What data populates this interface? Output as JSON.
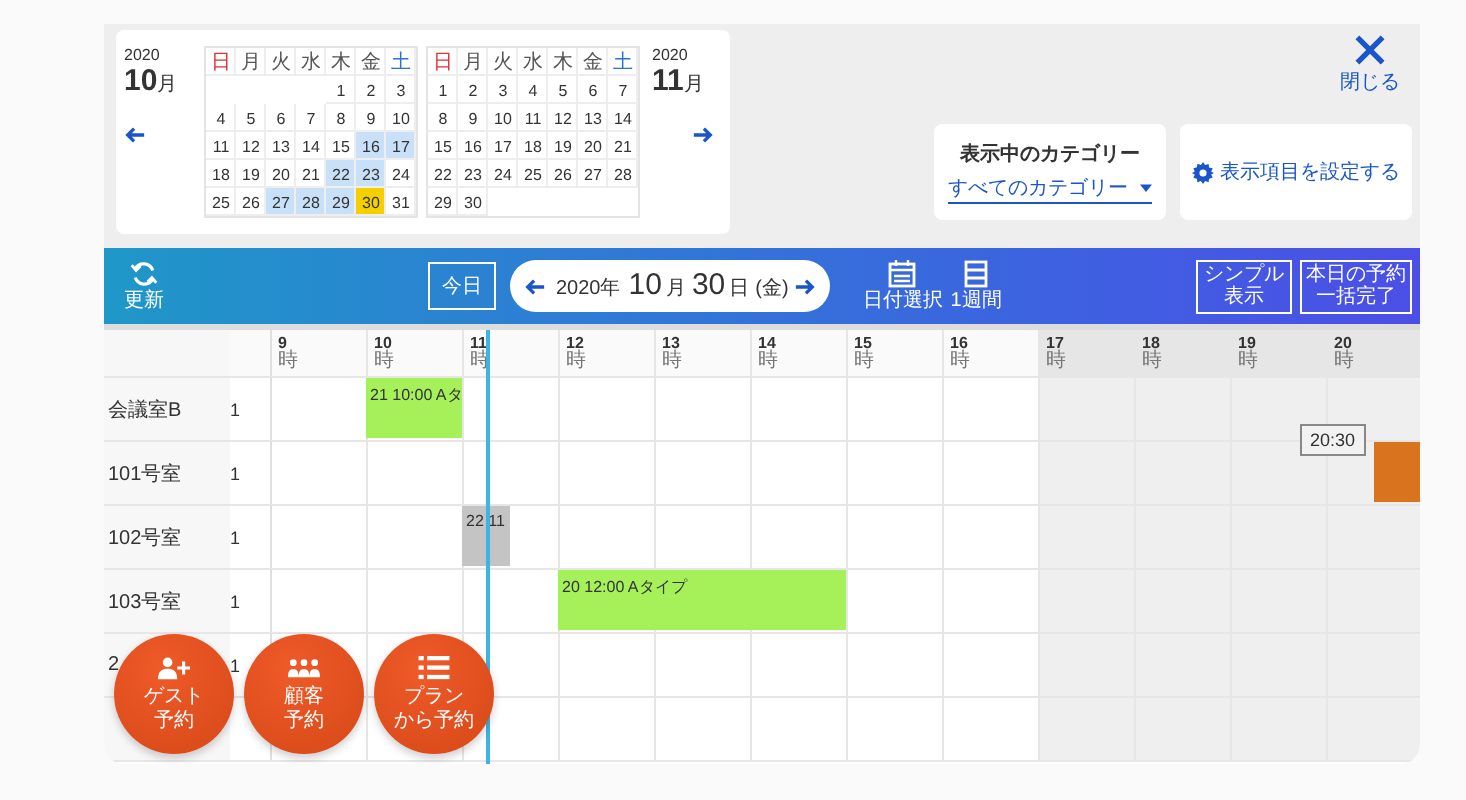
{
  "calendar": {
    "months": [
      {
        "year": "2020",
        "month": "10",
        "unit": "月",
        "weekdays": [
          {
            "label": "日",
            "kind": "sun"
          },
          {
            "label": "月",
            "kind": "day"
          },
          {
            "label": "火",
            "kind": "day"
          },
          {
            "label": "水",
            "kind": "day"
          },
          {
            "label": "木",
            "kind": "day"
          },
          {
            "label": "金",
            "kind": "day"
          },
          {
            "label": "土",
            "kind": "sat"
          }
        ],
        "weeks": [
          {
            "days": [
              {
                "day": "1",
                "selected": false,
                "today": false
              },
              {
                "day": "2",
                "selected": false,
                "today": false
              },
              {
                "day": "3",
                "selected": false,
                "today": false
              }
            ]
          },
          {
            "days": [
              {
                "day": "4",
                "selected": false,
                "today": false
              },
              {
                "day": "5",
                "selected": false,
                "today": false
              },
              {
                "day": "6",
                "selected": false,
                "today": false
              },
              {
                "day": "7",
                "selected": false,
                "today": false
              },
              {
                "day": "8",
                "selected": false,
                "today": false
              },
              {
                "day": "9",
                "selected": false,
                "today": false
              },
              {
                "day": "10",
                "selected": false,
                "today": false
              }
            ]
          },
          {
            "days": [
              {
                "day": "11",
                "selected": false,
                "today": false
              },
              {
                "day": "12",
                "selected": false,
                "today": false
              },
              {
                "day": "13",
                "selected": false,
                "today": false
              },
              {
                "day": "14",
                "selected": false,
                "today": false
              },
              {
                "day": "15",
                "selected": false,
                "today": false
              },
              {
                "day": "16",
                "selected": true,
                "today": false
              },
              {
                "day": "17",
                "selected": true,
                "today": false
              }
            ]
          },
          {
            "days": [
              {
                "day": "18",
                "selected": false,
                "today": false
              },
              {
                "day": "19",
                "selected": false,
                "today": false
              },
              {
                "day": "20",
                "selected": false,
                "today": false
              },
              {
                "day": "21",
                "selected": false,
                "today": false
              },
              {
                "day": "22",
                "selected": true,
                "today": false
              },
              {
                "day": "23",
                "selected": true,
                "today": false
              },
              {
                "day": "24",
                "selected": false,
                "today": false
              }
            ]
          },
          {
            "days": [
              {
                "day": "25",
                "selected": false,
                "today": false
              },
              {
                "day": "26",
                "selected": false,
                "today": false
              },
              {
                "day": "27",
                "selected": true,
                "today": false
              },
              {
                "day": "28",
                "selected": true,
                "today": false
              },
              {
                "day": "29",
                "selected": true,
                "today": false
              },
              {
                "day": "30",
                "selected": false,
                "today": true
              },
              {
                "day": "31",
                "selected": false,
                "today": false
              }
            ]
          }
        ]
      },
      {
        "year": "2020",
        "month": "11",
        "unit": "月",
        "weekdays": [
          {
            "label": "日",
            "kind": "sun"
          },
          {
            "label": "月",
            "kind": "day"
          },
          {
            "label": "火",
            "kind": "day"
          },
          {
            "label": "水",
            "kind": "day"
          },
          {
            "label": "木",
            "kind": "day"
          },
          {
            "label": "金",
            "kind": "day"
          },
          {
            "label": "土",
            "kind": "sat"
          }
        ],
        "weeks": [
          {
            "days": [
              {
                "day": "1",
                "selected": false,
                "today": false
              },
              {
                "day": "2",
                "selected": false,
                "today": false
              },
              {
                "day": "3",
                "selected": false,
                "today": false
              },
              {
                "day": "4",
                "selected": false,
                "today": false
              },
              {
                "day": "5",
                "selected": false,
                "today": false
              },
              {
                "day": "6",
                "selected": false,
                "today": false
              },
              {
                "day": "7",
                "selected": false,
                "today": false
              }
            ]
          },
          {
            "days": [
              {
                "day": "8",
                "selected": false,
                "today": false
              },
              {
                "day": "9",
                "selected": false,
                "today": false
              },
              {
                "day": "10",
                "selected": false,
                "today": false
              },
              {
                "day": "11",
                "selected": false,
                "today": false
              },
              {
                "day": "12",
                "selected": false,
                "today": false
              },
              {
                "day": "13",
                "selected": false,
                "today": false
              },
              {
                "day": "14",
                "selected": false,
                "today": false
              }
            ]
          },
          {
            "days": [
              {
                "day": "15",
                "selected": false,
                "today": false
              },
              {
                "day": "16",
                "selected": false,
                "today": false
              },
              {
                "day": "17",
                "selected": false,
                "today": false
              },
              {
                "day": "18",
                "selected": false,
                "today": false
              },
              {
                "day": "19",
                "selected": false,
                "today": false
              },
              {
                "day": "20",
                "selected": false,
                "today": false
              },
              {
                "day": "21",
                "selected": false,
                "today": false
              }
            ]
          },
          {
            "days": [
              {
                "day": "22",
                "selected": false,
                "today": false
              },
              {
                "day": "23",
                "selected": false,
                "today": false
              },
              {
                "day": "24",
                "selected": false,
                "today": false
              },
              {
                "day": "25",
                "selected": false,
                "today": false
              },
              {
                "day": "26",
                "selected": false,
                "today": false
              },
              {
                "day": "27",
                "selected": false,
                "today": false
              },
              {
                "day": "28",
                "selected": false,
                "today": false
              }
            ]
          },
          {
            "days": [
              {
                "day": "29",
                "selected": false,
                "today": false
              },
              {
                "day": "30",
                "selected": false,
                "today": false
              }
            ]
          }
        ]
      }
    ]
  },
  "category": {
    "title": "表示中のカテゴリー",
    "value": "すべてのカテゴリー"
  },
  "settings_button": "表示項目を設定する",
  "close_button": "閉じる",
  "toolbar": {
    "refresh": "更新",
    "today": "今日",
    "date": {
      "year": "2020年",
      "month": "10",
      "month_unit": "月",
      "day": "30",
      "day_unit": "日",
      "weekday": "(金)"
    },
    "date_pick": "日付選択",
    "week": "1週間",
    "simple": [
      "シンプル",
      "表示"
    ],
    "complete_all": [
      "本日の予約",
      "一括完了"
    ]
  },
  "hours": [
    {
      "label": "9",
      "unit": "時",
      "closed": false
    },
    {
      "label": "10",
      "unit": "時",
      "closed": false
    },
    {
      "label": "11",
      "unit": "時",
      "closed": false
    },
    {
      "label": "12",
      "unit": "時",
      "closed": false
    },
    {
      "label": "13",
      "unit": "時",
      "closed": false
    },
    {
      "label": "14",
      "unit": "時",
      "closed": false
    },
    {
      "label": "15",
      "unit": "時",
      "closed": false
    },
    {
      "label": "16",
      "unit": "時",
      "closed": false
    },
    {
      "label": "17",
      "unit": "時",
      "closed": true
    },
    {
      "label": "18",
      "unit": "時",
      "closed": true
    },
    {
      "label": "19",
      "unit": "時",
      "closed": true
    },
    {
      "label": "20",
      "unit": "時",
      "closed": true
    }
  ],
  "rooms": [
    {
      "kind": "room",
      "name": "会議室B",
      "count": "1",
      "events": [
        {
          "kind": "hour",
          "code": "21",
          "time": "10:00",
          "title": "Aタ",
          "color": "#a6f05a"
        }
      ]
    },
    {
      "kind": "room",
      "name": "101号室",
      "count": "1",
      "events": [
        {
          "kind": "half_hour",
          "tooltip": "20:30",
          "color": "#d9731e"
        }
      ]
    },
    {
      "kind": "room",
      "name": "102号室",
      "count": "1",
      "events": [
        {
          "kind": "half_hour",
          "code": "22",
          "time": "11",
          "color": "#c4c4c4"
        }
      ]
    },
    {
      "kind": "room",
      "name": "103号室",
      "count": "1",
      "events": [
        {
          "kind": "three_hours",
          "code": "20",
          "time": "12:00",
          "title": "Aタイプ",
          "color": "#a6f05a"
        }
      ]
    },
    {
      "kind": "room",
      "name": "2",
      "count": "1"
    },
    {
      "kind": "blank"
    }
  ],
  "actions": [
    {
      "kind": "guest",
      "lines": [
        "ゲスト",
        "予約"
      ]
    },
    {
      "kind": "customer",
      "lines": [
        "顧客",
        "予約"
      ]
    },
    {
      "kind": "plan",
      "lines": [
        "プラン",
        "から予約"
      ]
    }
  ]
}
